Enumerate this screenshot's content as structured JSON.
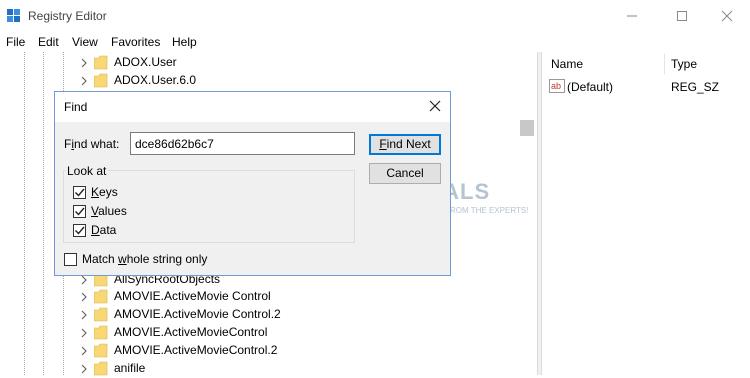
{
  "window": {
    "title": "Registry Editor"
  },
  "menu": [
    "File",
    "Edit",
    "View",
    "Favorites",
    "Help"
  ],
  "tree": [
    {
      "label": "ADOX.User"
    },
    {
      "label": "ADOX.User.6.0"
    },
    {
      "label": "AllSyncRootObjects"
    },
    {
      "label": "AMOVIE.ActiveMovie Control"
    },
    {
      "label": "AMOVIE.ActiveMovie Control.2"
    },
    {
      "label": "AMOVIE.ActiveMovieControl"
    },
    {
      "label": "AMOVIE.ActiveMovieControl.2"
    },
    {
      "label": "anifile"
    }
  ],
  "values_pane": {
    "columns": {
      "name": "Name",
      "type": "Type"
    },
    "rows": [
      {
        "name": "(Default)",
        "type": "REG_SZ",
        "icon": "string-value-icon"
      }
    ]
  },
  "find_dialog": {
    "title": "Find",
    "find_what_label_underlined": "i",
    "find_what_label_pre": "F",
    "find_what_label_post": "nd what:",
    "find_what_value": "dce86d62b6c7",
    "find_next_pre": "",
    "find_next_ul": "F",
    "find_next_post": "ind Next",
    "cancel_label": "Cancel",
    "look_at_label": "Look at",
    "checkboxes": [
      {
        "pre": "",
        "ul": "K",
        "post": "eys",
        "checked": true
      },
      {
        "pre": "",
        "ul": "V",
        "post": "alues",
        "checked": true
      },
      {
        "pre": "",
        "ul": "D",
        "post": "ata",
        "checked": true
      }
    ],
    "match_whole": {
      "pre": "Match ",
      "ul": "w",
      "post": "hole string only",
      "checked": false
    }
  },
  "watermark": {
    "brand": "APPUALS",
    "tagline": "TECH HOW-TO'S FROM THE EXPERTS!"
  },
  "colors": {
    "accent": "#0078d7",
    "folder": "#f8d775",
    "dialog_bg": "#f0f0f0"
  }
}
